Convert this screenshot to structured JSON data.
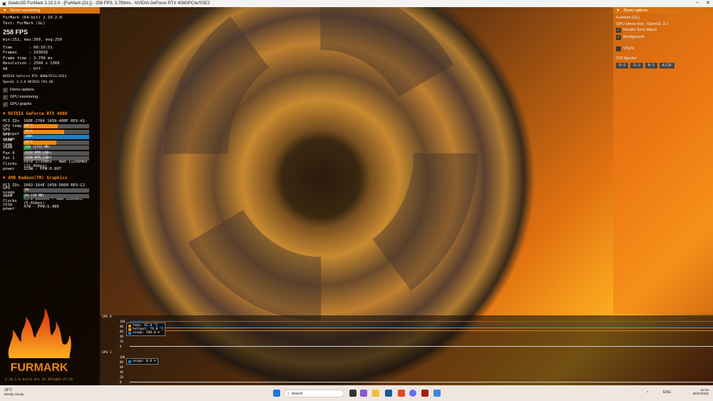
{
  "window": {
    "title": "Geeks3D FurMark 2.10.2.0 - [FurMark (GL)] - 258 FPS, 3.799ms - NVIDIA GeForce RTX 4080/PCIe/SSE2",
    "minimize": "–",
    "close": "✕"
  },
  "left": {
    "header": "Demo monitoring",
    "app": "FurMark (64-bit) 2.10.2.0",
    "test": "Test: FurMark (GL)",
    "fps": "258 FPS",
    "fps_stats": "min:252, max:309, avg:259",
    "stats": [
      "Time       : 00:10:51",
      "Frames     : 293658",
      "Frame time : 3.799 ms",
      "Resolution : 2560 x 1369",
      "AA         : Off"
    ],
    "renderer": "NVIDIA GeForce RTX 4080/PCIe/SSE2",
    "opengl": "OpenGL 3.3.0 NVIDIA 591.86",
    "checks": [
      "Demo options",
      "GPU monitoring",
      "GPU graphs"
    ],
    "gpu0": {
      "name": "NVIDIA GeForce RTX 4080",
      "pci": "10DE-2704 1458-40BF REV:A1",
      "bars": [
        {
          "k": "GPU temp",
          "v": "62°C",
          "p": 52,
          "c": "#f08a10"
        },
        {
          "k": "GPU hotspot",
          "v": "74°C",
          "p": 62,
          "c": "#f08a10"
        },
        {
          "k": "GPU usage",
          "v": "100%",
          "p": 100,
          "c": "#1e7fc8"
        },
        {
          "k": "VRAM temp",
          "v": "60°C",
          "p": 50,
          "c": "#f08a10"
        },
        {
          "k": "VRAM",
          "v": "11% (1721 MB)",
          "p": 11,
          "c": "#2a9a4a"
        },
        {
          "k": "Fan 0",
          "v": "1242 RPM (38%)",
          "p": 38,
          "c": "#777"
        },
        {
          "k": "Fan 1",
          "v": "1248 RPM (38%)",
          "p": 38,
          "c": "#777"
        }
      ],
      "clocks": "core 2730MHz - mem 11200MHz (22.4Gbps)",
      "power": "320W - PPW:0.807"
    },
    "gpu1": {
      "name": "AMD Radeon(TM) Graphics",
      "pci": "1002-164E 1458-D000 REV:C2",
      "bars": [
        {
          "k": "GPU usage",
          "v": "0%",
          "p": 0,
          "c": "#1e7fc8"
        },
        {
          "k": "VRAM",
          "v": "3% (16 MB)",
          "p": 3,
          "c": "#2a9a4a"
        }
      ],
      "clocks": "core 600MHz - mem 2800MHz (5.6Gbps)",
      "power": "47W - PPW:5.489"
    },
    "labels": {
      "pci": "PCI IDs",
      "clocks": "Clocks",
      "power": "power",
      "chip_power": "chip power"
    },
    "build": "2.10.2.0 build Oct 26 2025@07:47:59",
    "logo": "FURMARK"
  },
  "right": {
    "header": "Demo options",
    "title": "FurMark (GL)",
    "subtitle": "GPU stress test - OpenGL 3.2",
    "checks": [
      "Render furry object",
      "Background"
    ],
    "vsync": "VSync",
    "osi_label": "OSI bgcolor",
    "rgba": [
      "R: 0",
      "G: 0",
      "B: 0",
      "A:128"
    ]
  },
  "graphs": {
    "ticks": [
      "100",
      "80",
      "60",
      "40",
      "20",
      "0"
    ],
    "gpu0": {
      "label": "GPU 0",
      "legend": [
        "temp: 62.0 °C",
        "hotspot: 74.0 °C",
        "usage: 100.0 %"
      ]
    },
    "gpu1": {
      "label": "GPU 1",
      "legend": [
        "usage: 0.0 %"
      ]
    }
  },
  "taskbar": {
    "weather_temp": "18°C",
    "weather_text": "Mostly cloudy",
    "search": "Search",
    "lang": "ENG",
    "time": "22:04",
    "date": "25/01/2026"
  }
}
